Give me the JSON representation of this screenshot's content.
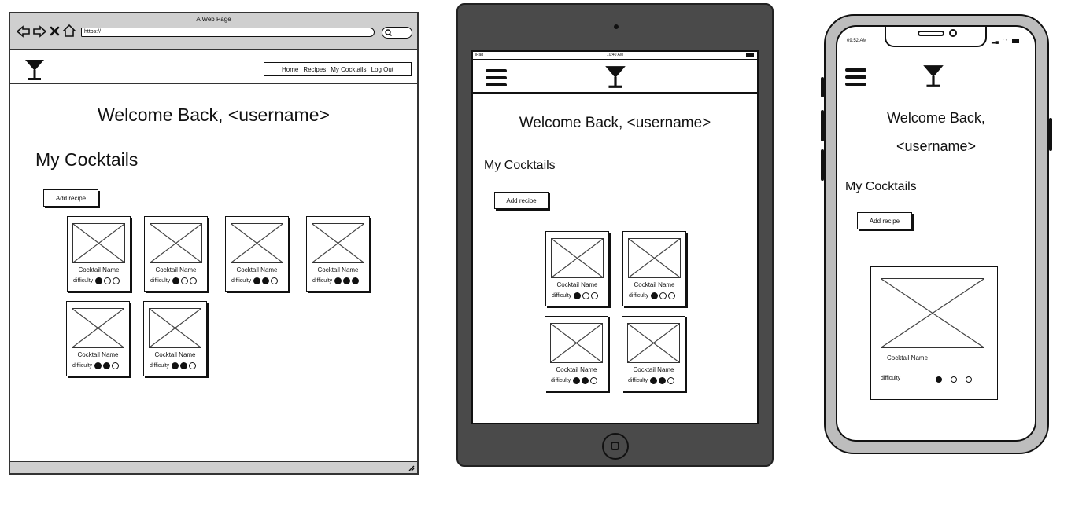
{
  "browser": {
    "title": "A Web Page",
    "url": "https://"
  },
  "desktop": {
    "nav": [
      "Home",
      "Recipes",
      "My Cocktails",
      "Log Out"
    ],
    "welcome": "Welcome Back, <username>",
    "section": "My Cocktails",
    "add_label": "Add recipe",
    "cards": [
      {
        "name": "Cocktail Name",
        "difficulty_label": "difficulty",
        "difficulty": 1
      },
      {
        "name": "Cocktail Name",
        "difficulty_label": "difficulty",
        "difficulty": 1
      },
      {
        "name": "Cocktail Name",
        "difficulty_label": "difficulty",
        "difficulty": 2
      },
      {
        "name": "Cocktail Name",
        "difficulty_label": "difficulty",
        "difficulty": 3
      },
      {
        "name": "Cocktail Name",
        "difficulty_label": "difficulty",
        "difficulty": 2
      },
      {
        "name": "Cocktail Name",
        "difficulty_label": "difficulty",
        "difficulty": 2
      }
    ]
  },
  "tablet": {
    "status_left": "iPad",
    "status_time": "10:40 AM",
    "welcome": "Welcome Back, <username>",
    "section": "My Cocktails",
    "add_label": "Add recipe",
    "cards": [
      {
        "name": "Cocktail Name",
        "difficulty_label": "difficulty",
        "difficulty": 1
      },
      {
        "name": "Cocktail Name",
        "difficulty_label": "difficulty",
        "difficulty": 1
      },
      {
        "name": "Cocktail Name",
        "difficulty_label": "difficulty",
        "difficulty": 2
      },
      {
        "name": "Cocktail Name",
        "difficulty_label": "difficulty",
        "difficulty": 2
      }
    ]
  },
  "phone": {
    "status_time": "09:52 AM",
    "welcome_line1": "Welcome Back,",
    "welcome_line2": "<username>",
    "section": "My Cocktails",
    "add_label": "Add recipe",
    "card": {
      "name": "Cocktail Name",
      "difficulty_label": "difficulty",
      "difficulty": 1
    }
  }
}
